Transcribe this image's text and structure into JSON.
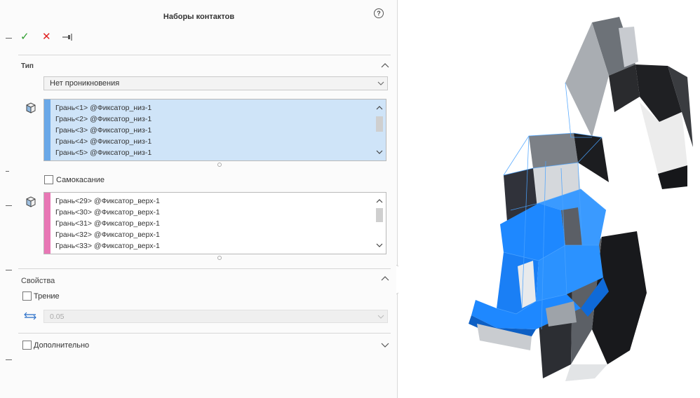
{
  "panel": {
    "title": "Наборы контактов",
    "help_icon": "question-icon",
    "toolbar": {
      "ok_icon": "✓",
      "cancel_icon": "✕",
      "pin_icon": "pin-icon"
    }
  },
  "type_section": {
    "title": "Тип",
    "contact_type": "Нет проникновения",
    "set1": {
      "items": [
        "Грань<1> @Фиксатор_низ-1",
        "Грань<2> @Фиксатор_низ-1",
        "Грань<3> @Фиксатор_низ-1",
        "Грань<4> @Фиксатор_низ-1",
        "Грань<5> @Фиксатор_низ-1"
      ],
      "stripe_color": "#6aa8e8",
      "bg_color": "#cfe4f8"
    },
    "self_contact_label": "Самокасание",
    "set2": {
      "items": [
        "Грань<29> @Фиксатор_верх-1",
        "Грань<30> @Фиксатор_верх-1",
        "Грань<31> @Фиксатор_верх-1",
        "Грань<32> @Фиксатор_верх-1",
        "Грань<33> @Фиксатор_верх-1"
      ],
      "stripe_color": "#e877b5",
      "bg_color": "#ffffff"
    }
  },
  "properties_section": {
    "title": "Свойства",
    "friction_label": "Трение",
    "friction_value": "0.05"
  },
  "advanced_section": {
    "title": "Дополнительно"
  },
  "colors": {
    "accent_blue": "#1e88ff",
    "part_dark": "#1d1d1f",
    "part_grey": "#8f949a"
  }
}
